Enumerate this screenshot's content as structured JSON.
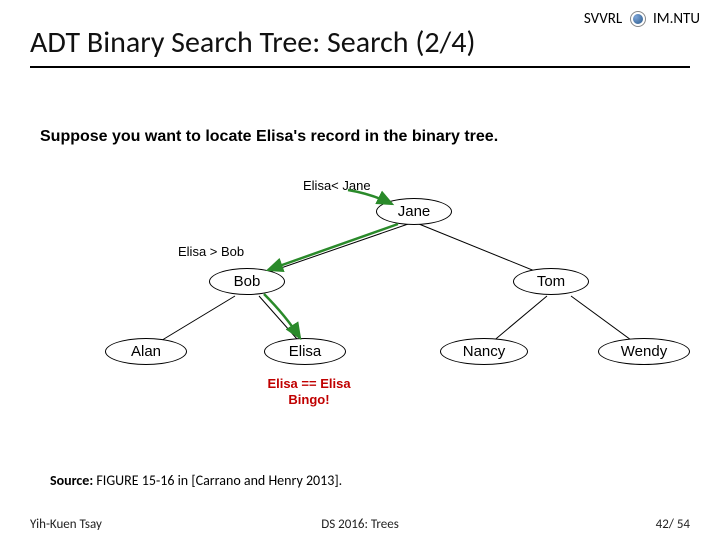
{
  "header": {
    "left_text": "SVVRL",
    "right_text": "IM.NTU"
  },
  "title": "ADT Binary Search Tree: Search (2/4)",
  "intro": "Suppose you want to locate Elisa's record in the binary tree.",
  "annotations": {
    "root_cmp": "Elisa< Jane",
    "left_cmp": "Elisa > Bob",
    "found": "Elisa == Elisa\nBingo!"
  },
  "nodes": {
    "root": "Jane",
    "l": "Bob",
    "r": "Tom",
    "ll": "Alan",
    "lr": "Elisa",
    "rl": "Nancy",
    "rr": "Wendy"
  },
  "source": {
    "label": "Source:",
    "text": "FIGURE 15-16 in [Carrano and Henry 2013]."
  },
  "footer": {
    "author": "Yih-Kuen Tsay",
    "course": "DS 2016: Trees",
    "page_current": "42",
    "page_sep": "/",
    "page_total": "54"
  }
}
